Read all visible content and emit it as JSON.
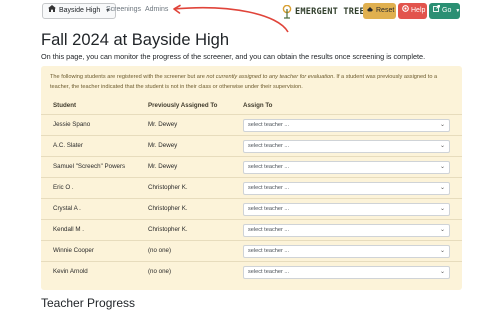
{
  "navbar": {
    "school_label": "Bayside High",
    "links": {
      "screenings": "Screenings",
      "admins": "Admins"
    },
    "logo_text": "EMERGENT TREE",
    "buttons": {
      "reset": "Reset",
      "help": "Help",
      "go": "Go"
    }
  },
  "page": {
    "title": "Fall 2024 at Bayside High",
    "intro": "On this page, you can monitor the progress of the screener, and you can obtain the results once screening is complete."
  },
  "notice": {
    "part1": "The following students are registered with the screener but are ",
    "emphasis": "not currently assigned to any teacher for evaluation",
    "part2": ". If a student was previously assigned to a teacher, the teacher indicated that the student is not in their class or otherwise under their supervision."
  },
  "table": {
    "headers": {
      "student": "Student",
      "previous": "Previously Assigned To",
      "assign": "Assign To"
    },
    "select_placeholder": "select teacher ...",
    "rows": [
      {
        "student": "Jessie Spano",
        "previous": "Mr. Dewey"
      },
      {
        "student": "A.C. Slater",
        "previous": "Mr. Dewey"
      },
      {
        "student": "Samuel \"Screech\" Powers",
        "previous": "Mr. Dewey"
      },
      {
        "student": "Eric O .",
        "previous": "Christopher K."
      },
      {
        "student": "Crystal A .",
        "previous": "Christopher K."
      },
      {
        "student": "Kendall M .",
        "previous": "Christopher K."
      },
      {
        "student": "Winnie Cooper",
        "previous": "(no one)"
      },
      {
        "student": "Kevin Arnold",
        "previous": "(no one)"
      }
    ]
  },
  "teacher_progress": {
    "title": "Teacher Progress"
  },
  "colors": {
    "reset": "#e0b04f",
    "help": "#e2544d",
    "go": "#2b8f73",
    "panel": "#fcf3d9",
    "annotation_arrow": "#e0443a"
  }
}
